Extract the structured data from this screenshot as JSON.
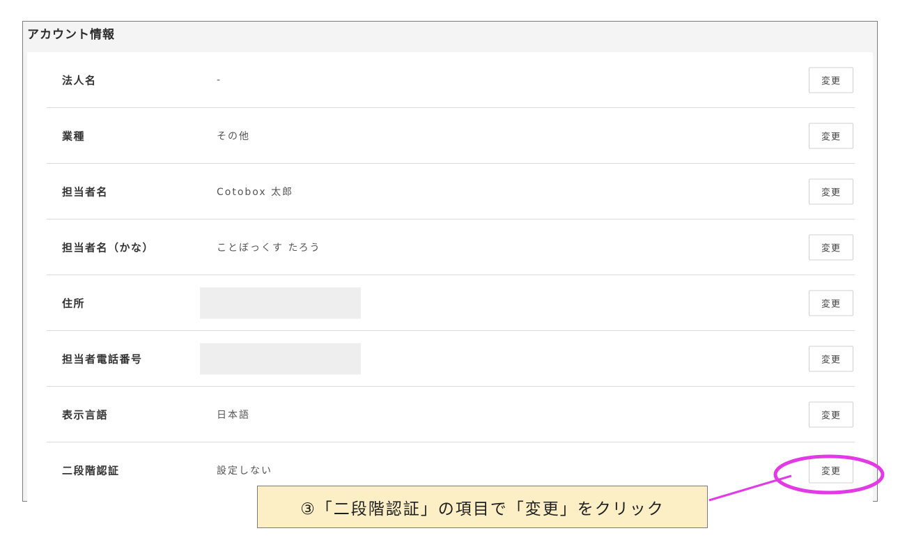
{
  "panel": {
    "title": "アカウント情報"
  },
  "rows": [
    {
      "label": "法人名",
      "value": "-",
      "button": "変更"
    },
    {
      "label": "業種",
      "value": "その他",
      "button": "変更"
    },
    {
      "label": "担当者名",
      "value": "Cotobox 太郎",
      "button": "変更"
    },
    {
      "label": "担当者名（かな）",
      "value": "ことぼっくす たろう",
      "button": "変更"
    },
    {
      "label": "住所",
      "value": "",
      "masked": true,
      "button": "変更"
    },
    {
      "label": "担当者電話番号",
      "value": "",
      "masked": true,
      "button": "変更"
    },
    {
      "label": "表示言語",
      "value": "日本語",
      "button": "変更"
    },
    {
      "label": "二段階認証",
      "value": "設定しない",
      "button": "変更"
    }
  ],
  "annotation": {
    "callout_text": "③「二段階認証」の項目で「変更」をクリック",
    "highlight_color": "#e23be6",
    "callout_bg": "#fcefc6"
  }
}
